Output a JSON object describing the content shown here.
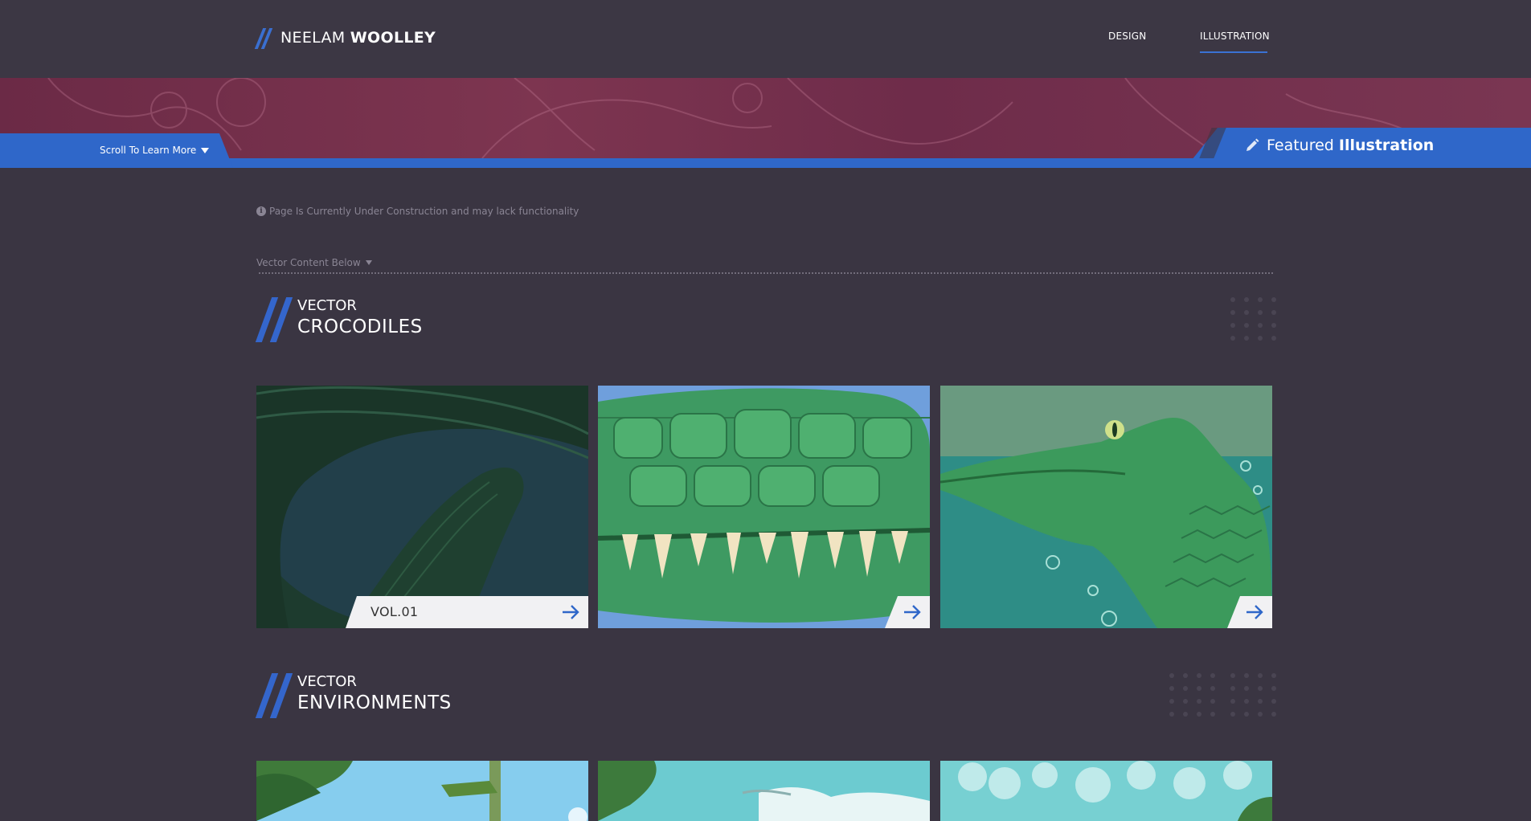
{
  "header": {
    "logo_first": "NEELAM",
    "logo_last": "WOOLLEY",
    "nav": [
      {
        "label": "DESIGN",
        "active": false
      },
      {
        "label": "ILLUSTRATION",
        "active": true
      }
    ],
    "accent_color": "#2f67c9"
  },
  "banner": {
    "scroll_label": "Scroll To Learn More",
    "featured_prefix": "Featured",
    "featured_strong": "Illustration"
  },
  "notice": {
    "text": "Page Is Currently Under Construction and may lack functionality",
    "icon": "info-icon"
  },
  "content_hint": "Vector Content Below",
  "sections": [
    {
      "small": "VECTOR",
      "big": "CROCODILES",
      "cards": [
        {
          "label": "VOL.01",
          "icon": "arrow-right-icon"
        },
        {
          "label": "",
          "icon": "arrow-right-icon"
        },
        {
          "label": "",
          "icon": "arrow-right-icon"
        }
      ]
    },
    {
      "small": "VECTOR",
      "big": "ENVIRONMENTS"
    }
  ]
}
